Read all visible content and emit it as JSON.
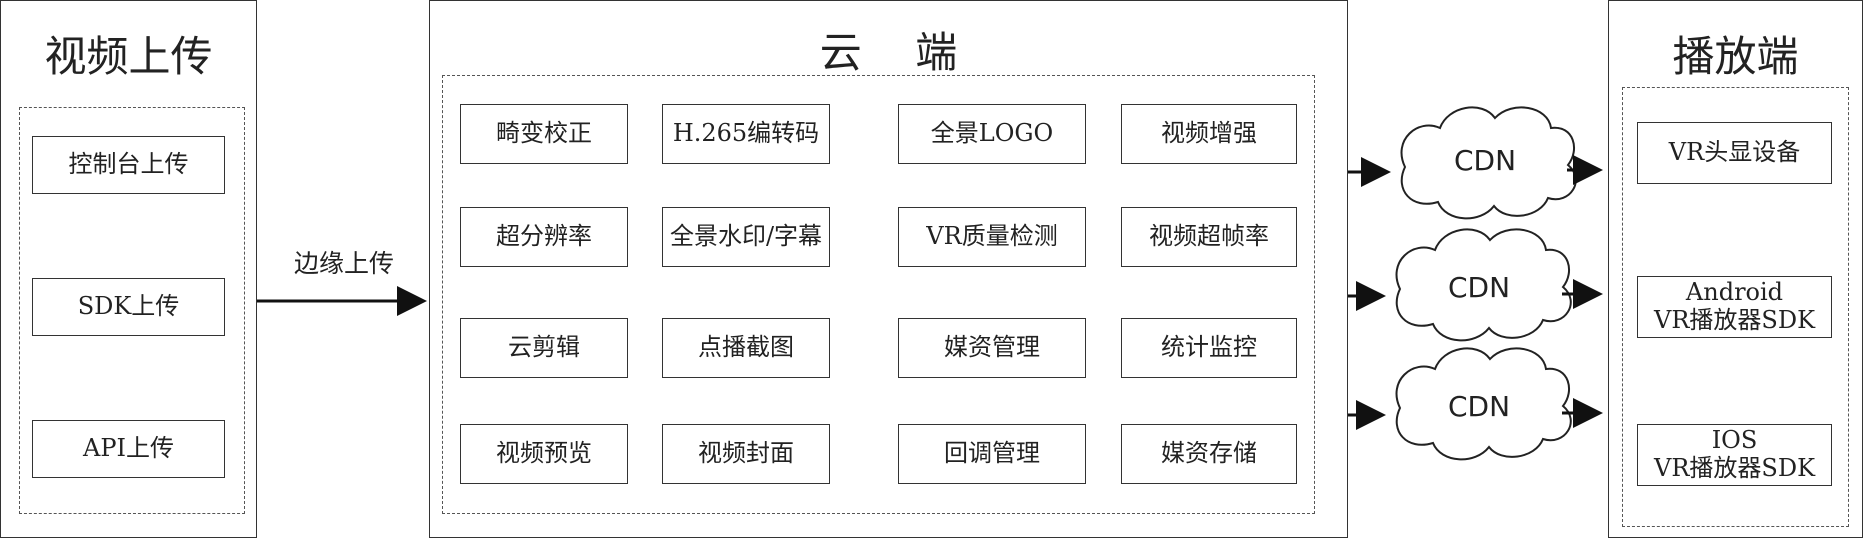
{
  "upload": {
    "title": "视频上传",
    "items": [
      "控制台上传",
      "SDK上传",
      "API上传"
    ]
  },
  "edge_label": "边缘上传",
  "cloud": {
    "title": "云    端",
    "features": [
      [
        "畸变校正",
        "H.265编转码",
        "全景LOGO",
        "视频增强"
      ],
      [
        "超分辨率",
        "全景水印/字幕",
        "VR质量检测",
        "视频超帧率"
      ],
      [
        "云剪辑",
        "点播截图",
        "媒资管理",
        "统计监控"
      ],
      [
        "视频预览",
        "视频封面",
        "回调管理",
        "媒资存储"
      ]
    ]
  },
  "cdn": [
    "CDN",
    "CDN",
    "CDN"
  ],
  "player": {
    "title": "播放端",
    "items": [
      "VR头显设备",
      "Android\nVR播放器SDK",
      "IOS\nVR播放器SDK"
    ]
  }
}
